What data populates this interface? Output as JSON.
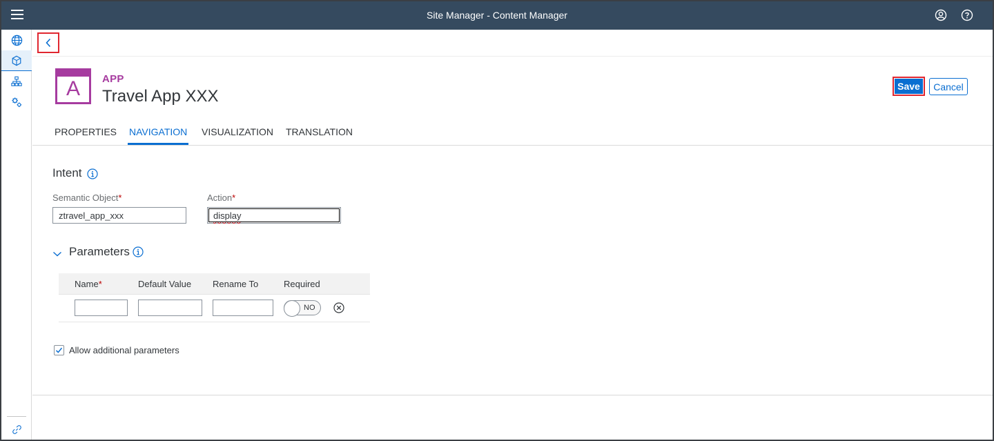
{
  "shell": {
    "title": "Site Manager - Content Manager",
    "menu_icon": "hamburger-menu-icon",
    "user_icon": "user-account-icon",
    "help_icon": "help-icon"
  },
  "sidenav": {
    "items": [
      {
        "icon": "globe-icon",
        "active": false
      },
      {
        "icon": "content-cube-icon",
        "active": true
      },
      {
        "icon": "hierarchy-icon",
        "active": false
      },
      {
        "icon": "settings-gears-icon",
        "active": false
      }
    ],
    "footer_icon": "link-icon"
  },
  "app": {
    "type_label": "APP",
    "icon_letter": "A",
    "title": "Travel App XXX",
    "accent_color": "#a63b9f"
  },
  "actions": {
    "save_label": "Save",
    "cancel_label": "Cancel"
  },
  "tabs": [
    {
      "label": "PROPERTIES",
      "active": false
    },
    {
      "label": "NAVIGATION",
      "active": true
    },
    {
      "label": "VISUALIZATION",
      "active": false
    },
    {
      "label": "TRANSLATION",
      "active": false
    }
  ],
  "intent": {
    "title": "Intent",
    "semantic_object_label": "Semantic Object",
    "semantic_object_value": "ztravel_app_xxx",
    "action_label": "Action",
    "action_value": "display",
    "required_marker": "*"
  },
  "parameters": {
    "title": "Parameters",
    "columns": [
      "Name",
      "Default Value",
      "Rename To",
      "Required"
    ],
    "rows": [
      {
        "name": "",
        "default_value": "",
        "rename_to": "",
        "required": "NO"
      }
    ],
    "allow_additional_label": "Allow additional parameters",
    "allow_additional_checked": true
  },
  "colors": {
    "shell_bg": "#354a5f",
    "primary": "#0a6ed1",
    "highlight": "#e0262f"
  }
}
